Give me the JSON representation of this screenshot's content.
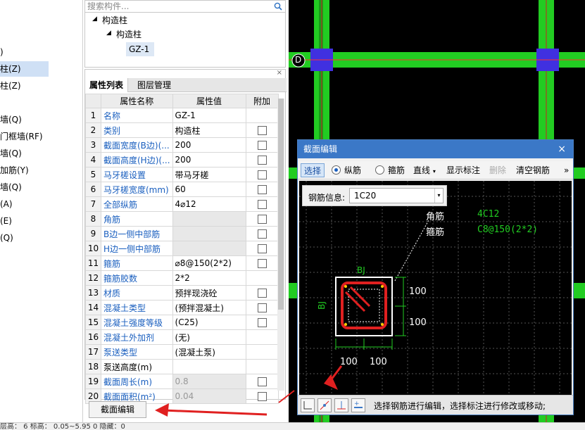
{
  "left_nav": {
    "items": [
      "",
      ")",
      "柱(Z)",
      "柱(Z)",
      "墙(Q)",
      "门框墙(RF)",
      "墙(Q)",
      "加筋(Y)",
      "墙(Q)",
      "(A)",
      "(E)",
      "(Q)"
    ]
  },
  "search": {
    "placeholder": "搜索构件..."
  },
  "tree": {
    "root": "构造柱",
    "child": "构造柱",
    "leaf": "GZ-1"
  },
  "props": {
    "tabs": [
      "属性列表",
      "图层管理"
    ],
    "headers": [
      "属性名称",
      "属性值",
      "附加"
    ],
    "rows": [
      {
        "n": "1",
        "name": "名称",
        "value": "GZ-1",
        "cb": false
      },
      {
        "n": "2",
        "name": "类别",
        "value": "构造柱",
        "cb": true
      },
      {
        "n": "3",
        "name": "截面宽度(B边)(...",
        "value": "200",
        "cb": true
      },
      {
        "n": "4",
        "name": "截面高度(H边)(...",
        "value": "200",
        "cb": true
      },
      {
        "n": "5",
        "name": "马牙槎设置",
        "value": "带马牙槎",
        "cb": true
      },
      {
        "n": "6",
        "name": "马牙槎宽度(mm)",
        "value": "60",
        "cb": true
      },
      {
        "n": "7",
        "name": "全部纵筋",
        "value": "4⌀12",
        "cb": true
      },
      {
        "n": "8",
        "name": "角筋",
        "value": "",
        "cb": true
      },
      {
        "n": "9",
        "name": "B边一侧中部筋",
        "value": "",
        "cb": true
      },
      {
        "n": "10",
        "name": "H边一侧中部筋",
        "value": "",
        "cb": true
      },
      {
        "n": "11",
        "name": "箍筋",
        "value": "⌀8@150(2*2)",
        "cb": true
      },
      {
        "n": "12",
        "name": "箍筋胶数",
        "value": "2*2",
        "cb": false
      },
      {
        "n": "13",
        "name": "材质",
        "value": "预拌现浇砼",
        "cb": true
      },
      {
        "n": "14",
        "name": "混凝土类型",
        "value": "(预拌混凝土)",
        "cb": true
      },
      {
        "n": "15",
        "name": "混凝土强度等级",
        "value": "(C25)",
        "cb": true
      },
      {
        "n": "16",
        "name": "混凝土外加剂",
        "value": "(无)",
        "cb": false
      },
      {
        "n": "17",
        "name": "泵送类型",
        "value": "(混凝土泵)",
        "cb": false
      },
      {
        "n": "18",
        "name": "泵送高度(m)",
        "value": "",
        "cb": false
      },
      {
        "n": "19",
        "name": "截面周长(m)",
        "value": "0.8",
        "cb": true
      },
      {
        "n": "20",
        "name": "截面面积(m²)",
        "value": "0.04",
        "cb": true
      }
    ],
    "section_edit_button": "截面编辑"
  },
  "canvas": {
    "axis_label": "D"
  },
  "dialog": {
    "title": "截面编辑",
    "close": "×",
    "toolbar": {
      "select": "选择",
      "longitudinal": "纵筋",
      "stirrup": "箍筋",
      "line": "直线",
      "show_label": "显示标注",
      "delete": "删除",
      "clear": "清空钢筋",
      "more": "»"
    },
    "rebar_info_label": "钢筋信息:",
    "rebar_info_value": "1C20",
    "labels": {
      "corner": "角筋",
      "corner_val": "4C12",
      "stirrup": "箍筋",
      "stirrup_val": "C8@150(2*2)",
      "bj_top": "BJ",
      "bj_left": "BJ",
      "d1": "100",
      "d2": "100",
      "d3": "100",
      "d4": "100"
    },
    "status_text": "选择钢筋进行编辑，选择标注进行修改或移动;"
  },
  "status_bar": {
    "text": "层高：   6       标高：  0.05~5.95       0                                    隐藏：0"
  },
  "colors": {
    "green": "#22cc22",
    "blue": "#3b78c7",
    "red": "#e02020"
  }
}
